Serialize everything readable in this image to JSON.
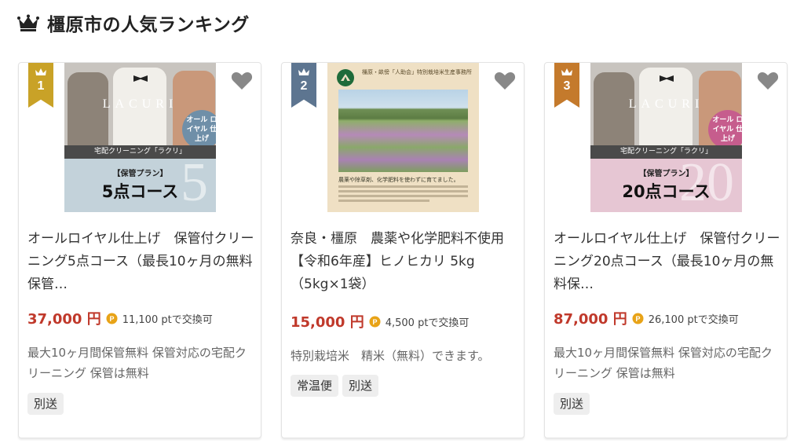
{
  "header": {
    "title": "橿原市の人気ランキング"
  },
  "cards": [
    {
      "rank": "1",
      "title": "オールロイヤル仕上げ　保管付クリーニング5点コース（最長10ヶ月の無料保管…",
      "price": "37,000 円",
      "points": "11,100 ptで交換可",
      "description": "最大10ヶ月間保管無料 保管対応の宅配クリーニング 保管は無料",
      "tags": [
        "別送"
      ],
      "thumb": {
        "brand": "LACURI",
        "badge": "オール ロイヤル 仕上げ",
        "strip": "宅配クリーニング「ラクリ」",
        "plan": "【保管プラン】",
        "course": "5点コース",
        "bignum": "5"
      }
    },
    {
      "rank": "2",
      "title": "奈良・橿原　農薬や化学肥料不使用【令和6年産】ヒノヒカリ 5kg（5kg×1袋）",
      "price": "15,000 円",
      "points": "4,500 ptで交換可",
      "description": "特別栽培米　精米（無料）できます。",
      "tags": [
        "常温便",
        "別送"
      ],
      "thumb": {
        "heading": "橿原・畝傍「人助会」特別栽培米生産事務所",
        "caption": "農薬や除草剤、化学肥料を使わずに育てました。"
      }
    },
    {
      "rank": "3",
      "title": "オールロイヤル仕上げ　保管付クリーニング20点コース（最長10ヶ月の無料保…",
      "price": "87,000 円",
      "points": "26,100 ptで交換可",
      "description": "最大10ヶ月間保管無料 保管対応の宅配クリーニング 保管は無料",
      "tags": [
        "別送"
      ],
      "thumb": {
        "brand": "LACURI",
        "badge": "オール ロイヤル 仕上げ",
        "strip": "宅配クリーニング「ラクリ」",
        "plan": "【保管プラン】",
        "course": "20点コース",
        "bignum": "20"
      }
    }
  ],
  "icons": {
    "header": "crown-icon",
    "favorite": "heart-icon",
    "point": "point-icon"
  },
  "colors": {
    "rank1": "#c9a227",
    "rank2": "#5d7590",
    "rank3": "#c47a2c",
    "price": "#c0392b",
    "point": "#e8a317",
    "heart": "#888888"
  }
}
